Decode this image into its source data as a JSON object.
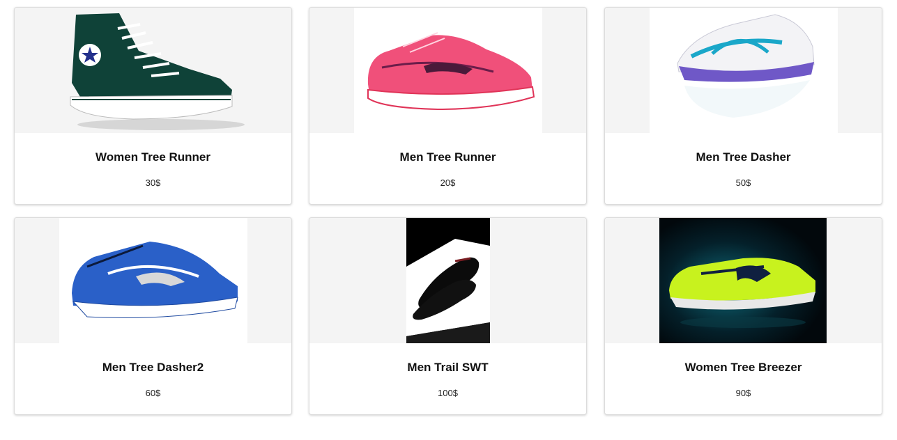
{
  "products": [
    {
      "name": "Women Tree Runner",
      "price": "30$",
      "image_icon": "hightop-canvas-sneaker-icon"
    },
    {
      "name": "Men Tree Runner",
      "price": "20$",
      "image_icon": "pink-running-shoe-icon"
    },
    {
      "name": "Men Tree Dasher",
      "price": "50$",
      "image_icon": "white-blue-running-shoe-icon"
    },
    {
      "name": "Men Tree Dasher2",
      "price": "60$",
      "image_icon": "blue-running-shoe-icon"
    },
    {
      "name": "Men Trail SWT",
      "price": "100$",
      "image_icon": "black-dress-shoes-icon"
    },
    {
      "name": "Women Tree Breezer",
      "price": "90$",
      "image_icon": "neon-running-shoe-icon"
    }
  ],
  "colors": {
    "card_border": "#dcdcdc",
    "image_background": "#f4f4f4"
  }
}
